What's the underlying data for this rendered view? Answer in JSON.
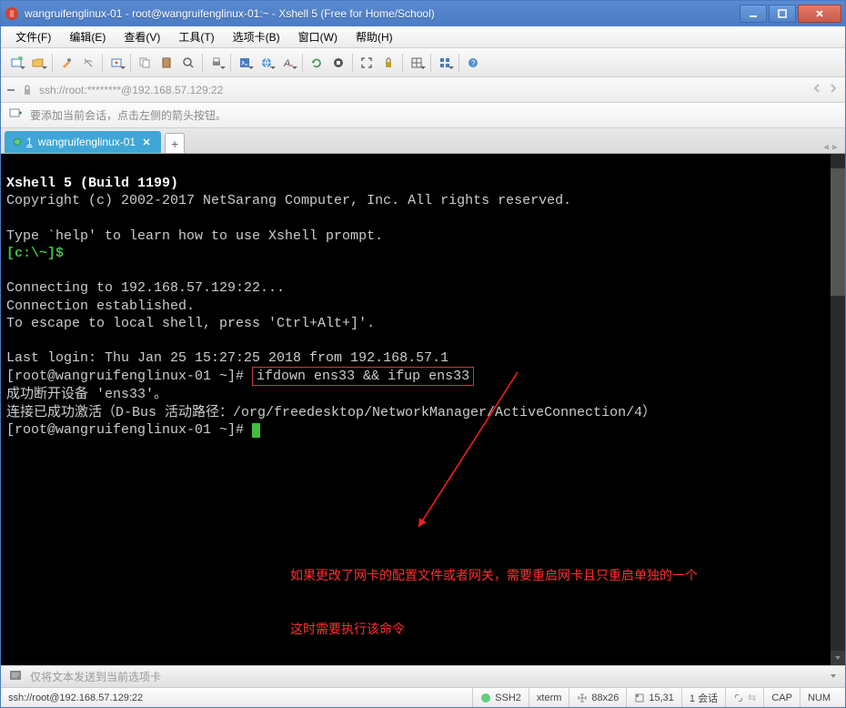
{
  "titlebar": {
    "text": "wangruifenglinux-01 - root@wangruifenglinux-01:~ - Xshell 5 (Free for Home/School)"
  },
  "menu": {
    "file": "文件(F)",
    "edit": "编辑(E)",
    "view": "查看(V)",
    "tools": "工具(T)",
    "tabs": "选项卡(B)",
    "window": "窗口(W)",
    "help": "帮助(H)"
  },
  "addressbar": {
    "text": "ssh://root:********@192.168.57.129:22"
  },
  "infobar": {
    "text": "要添加当前会话，点击左侧的箭头按钮。"
  },
  "tab": {
    "index": "1",
    "label": "wangruifenglinux-01"
  },
  "terminal": {
    "line1": "Xshell 5 (Build 1199)",
    "line2": "Copyright (c) 2002-2017 NetSarang Computer, Inc. All rights reserved.",
    "line3": "Type `help' to learn how to use Xshell prompt.",
    "prompt_local": "[c:\\~]$",
    "line_conn1": "Connecting to 192.168.57.129:22...",
    "line_conn2": "Connection established.",
    "line_conn3": "To escape to local shell, press 'Ctrl+Alt+]'.",
    "line_last": "Last login: Thu Jan 25 15:27:25 2018 from 192.168.57.1",
    "prompt_remote": "[root@wangruifenglinux-01 ~]# ",
    "cmd_box": "ifdown ens33 && ifup ens33",
    "line_out1": "成功断开设备 'ens33'。",
    "line_out2": "连接已成功激活（D-Bus 活动路径：/org/freedesktop/NetworkManager/ActiveConnection/4）",
    "annot1": "如果更改了网卡的配置文件或者网关，需要重启网卡且只重启单独的一个",
    "annot2": "这时需要执行该命令"
  },
  "footer": {
    "placeholder": "仅将文本发送到当前选项卡"
  },
  "status": {
    "conn": "ssh://root@192.168.57.129:22",
    "ssh": "SSH2",
    "term": "xterm",
    "size": "88x26",
    "pos": "15,31",
    "sess": "1 会话",
    "cap": "CAP",
    "num": "NUM"
  }
}
